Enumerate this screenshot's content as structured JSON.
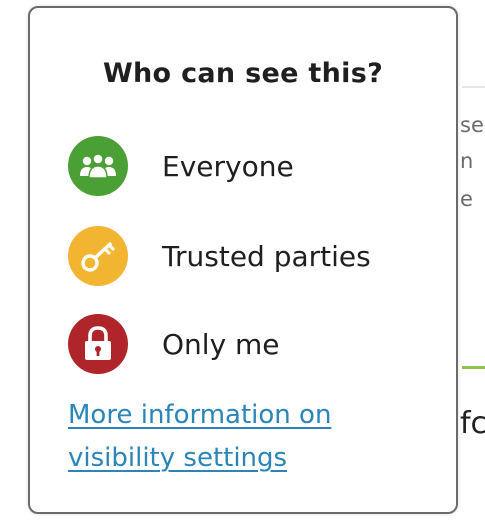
{
  "background": {
    "snippet_lines": [
      "se",
      "n",
      "e"
    ],
    "snippet_bottom": "fc"
  },
  "popover": {
    "title": "Who can see this?",
    "options": [
      {
        "label": "Everyone",
        "icon": "group-icon",
        "color": "#4a9f35"
      },
      {
        "label": "Trusted parties",
        "icon": "key-icon",
        "color": "#f2b531"
      },
      {
        "label": "Only me",
        "icon": "lock-icon",
        "color": "#b0252a"
      }
    ],
    "info_link": "More information on visibility settings"
  }
}
